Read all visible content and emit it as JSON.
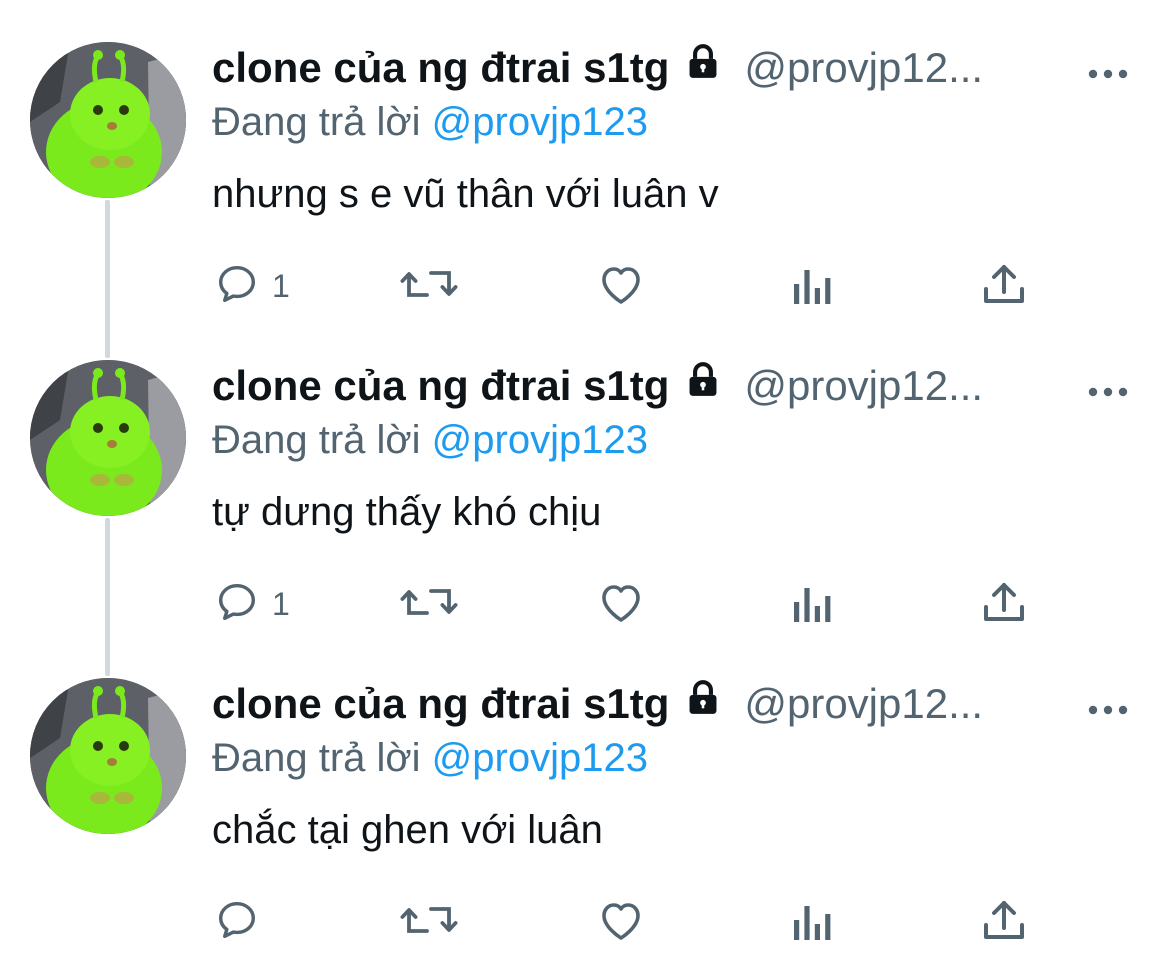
{
  "colors": {
    "text_primary": "#0f1419",
    "text_secondary": "#536471",
    "link_blue": "#1d9bf0",
    "thread_line": "#cfd9de",
    "avatar_green": "#7bea1c"
  },
  "icons": {
    "lock": "lock-icon",
    "more": "more-icon",
    "reply": "reply-icon",
    "retweet": "retweet-icon",
    "like": "heart-icon",
    "views": "views-icon",
    "share": "share-icon"
  },
  "tweets": [
    {
      "name": "clone của ng đtrai s1tg",
      "handle": "@provjp12...",
      "reply_prefix": "Đang trả lời",
      "reply_to": "@provjp123",
      "text": "nhưng s e vũ thân với luân v",
      "reply_count": "1"
    },
    {
      "name": "clone của ng đtrai s1tg",
      "handle": "@provjp12...",
      "reply_prefix": "Đang trả lời",
      "reply_to": "@provjp123",
      "text": "tự dưng thấy khó chịu",
      "reply_count": "1"
    },
    {
      "name": "clone của ng đtrai s1tg",
      "handle": "@provjp12...",
      "reply_prefix": "Đang trả lời",
      "reply_to": "@provjp123",
      "text": "chắc tại ghen với luân",
      "reply_count": ""
    }
  ]
}
